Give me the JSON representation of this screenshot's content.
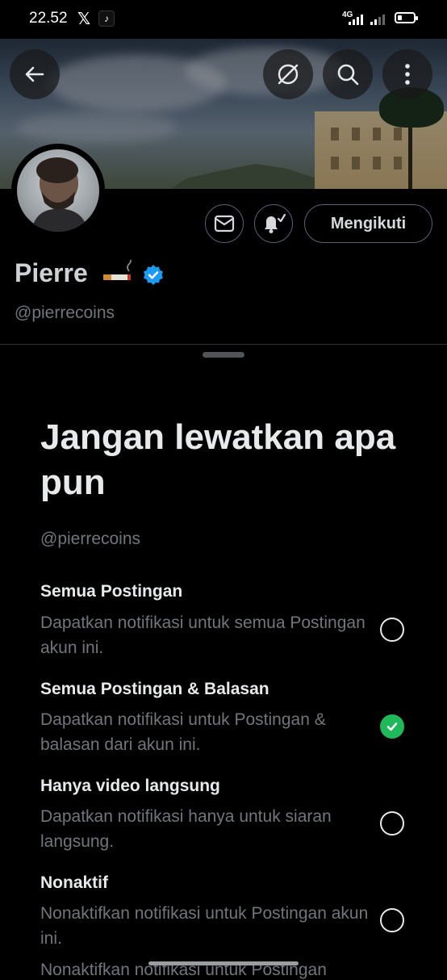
{
  "status_bar": {
    "time": "22.52",
    "network": "4G"
  },
  "profile": {
    "name": "Pierre",
    "handle": "@pierrecoins",
    "follow_label": "Mengikuti",
    "verified_color": "#1d9bf0"
  },
  "sheet": {
    "title": "Jangan lewatkan apa pun",
    "handle": "@pierrecoins",
    "options": [
      {
        "title": "Semua Postingan",
        "description": "Dapatkan notifikasi untuk semua Postingan akun ini.",
        "selected": false
      },
      {
        "title": "Semua Postingan & Balasan",
        "description": "Dapatkan notifikasi untuk Postingan & balasan dari akun ini.",
        "selected": true
      },
      {
        "title": "Hanya video langsung",
        "description": "Dapatkan notifikasi hanya untuk siaran langsung.",
        "selected": false
      },
      {
        "title": "Nonaktif",
        "description": "Nonaktifkan notifikasi untuk Postingan akun ini.",
        "selected": false
      }
    ],
    "cut_off_text": "Nonaktifkan notifikasi untuk Postingan"
  },
  "colors": {
    "accent_green": "#1fb85a",
    "secondary_text": "#71767b"
  }
}
